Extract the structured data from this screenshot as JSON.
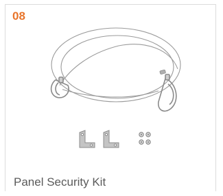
{
  "card": {
    "item_number": "08",
    "product_name": "Panel Security Kit",
    "image_icon": "security-cable-kit-image"
  },
  "colors": {
    "accent": "#e8742a",
    "text": "#5a5a5a",
    "border": "#dcdcdc"
  }
}
